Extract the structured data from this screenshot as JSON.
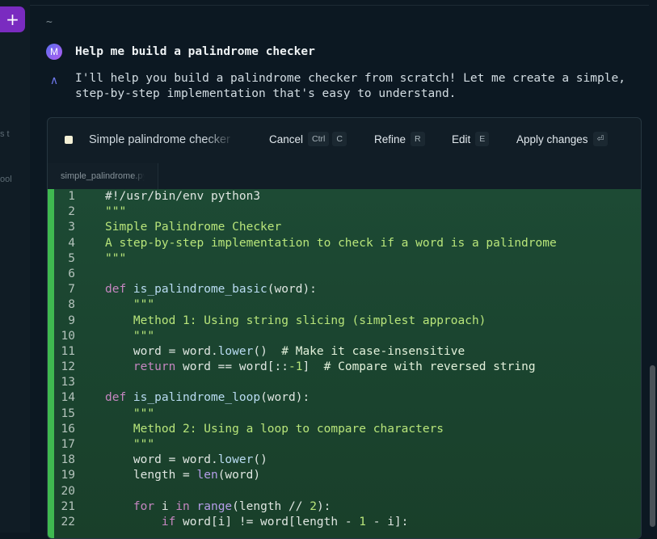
{
  "sidebar": {
    "new_button": "+",
    "fragment1": "s t",
    "fragment2": "ool"
  },
  "terminal": {
    "prompt": "~"
  },
  "conversation": {
    "user_avatar": "M",
    "user_message": "Help me build a palindrome checker",
    "assistant_icon": "∧",
    "assistant_message": "I'll help you build a palindrome checker from scratch! Let me create a simple, step-by-step implementation that's easy to understand."
  },
  "panel": {
    "title": "Simple palindrome checker",
    "actions": [
      {
        "label": "Cancel",
        "keys": [
          "Ctrl",
          "C"
        ]
      },
      {
        "label": "Refine",
        "keys": [
          "R"
        ]
      },
      {
        "label": "Edit",
        "keys": [
          "E"
        ]
      },
      {
        "label": "Apply changes",
        "keys": [
          "⏎"
        ]
      }
    ],
    "tab": "simple_palindrome.py"
  },
  "code_lines": [
    {
      "n": "1",
      "t": [
        [
          "",
          "#!/usr/bin/env python3"
        ]
      ]
    },
    {
      "n": "2",
      "t": [
        [
          "str",
          "\"\"\""
        ]
      ]
    },
    {
      "n": "3",
      "t": [
        [
          "str",
          "Simple Palindrome Checker"
        ]
      ]
    },
    {
      "n": "4",
      "t": [
        [
          "str",
          "A step-by-step implementation to check if a word is a palindrome"
        ]
      ]
    },
    {
      "n": "5",
      "t": [
        [
          "str",
          "\"\"\""
        ]
      ]
    },
    {
      "n": "6",
      "t": [
        [
          "",
          ""
        ]
      ]
    },
    {
      "n": "7",
      "t": [
        [
          "kw",
          "def "
        ],
        [
          "fn",
          "is_palindrome_basic"
        ],
        [
          "",
          "(word):"
        ]
      ]
    },
    {
      "n": "8",
      "t": [
        [
          "str",
          "    \"\"\""
        ]
      ]
    },
    {
      "n": "9",
      "t": [
        [
          "str",
          "    Method 1: Using string slicing (simplest approach)"
        ]
      ]
    },
    {
      "n": "10",
      "t": [
        [
          "str",
          "    \"\"\""
        ]
      ]
    },
    {
      "n": "11",
      "t": [
        [
          "",
          "    word = word."
        ],
        [
          "fn",
          "lower"
        ],
        [
          "",
          "()  "
        ],
        [
          "cm",
          "# Make it case-insensitive"
        ]
      ]
    },
    {
      "n": "12",
      "t": [
        [
          "kw",
          "    return "
        ],
        [
          "",
          "word == word[::"
        ],
        [
          "num",
          "-1"
        ],
        [
          "",
          "]  "
        ],
        [
          "cm",
          "# Compare with reversed string"
        ]
      ]
    },
    {
      "n": "13",
      "t": [
        [
          "",
          ""
        ]
      ]
    },
    {
      "n": "14",
      "t": [
        [
          "kw",
          "def "
        ],
        [
          "fn",
          "is_palindrome_loop"
        ],
        [
          "",
          "(word):"
        ]
      ]
    },
    {
      "n": "15",
      "t": [
        [
          "str",
          "    \"\"\""
        ]
      ]
    },
    {
      "n": "16",
      "t": [
        [
          "str",
          "    Method 2: Using a loop to compare characters"
        ]
      ]
    },
    {
      "n": "17",
      "t": [
        [
          "str",
          "    \"\"\""
        ]
      ]
    },
    {
      "n": "18",
      "t": [
        [
          "",
          "    word = word."
        ],
        [
          "fn",
          "lower"
        ],
        [
          "",
          "()"
        ]
      ]
    },
    {
      "n": "19",
      "t": [
        [
          "",
          "    length = "
        ],
        [
          "bi",
          "len"
        ],
        [
          "",
          "(word)"
        ]
      ]
    },
    {
      "n": "20",
      "t": [
        [
          "",
          ""
        ]
      ]
    },
    {
      "n": "21",
      "t": [
        [
          "kw",
          "    for "
        ],
        [
          "",
          "i "
        ],
        [
          "kw",
          "in "
        ],
        [
          "bi",
          "range"
        ],
        [
          "",
          "(length // "
        ],
        [
          "num",
          "2"
        ],
        [
          "",
          "):"
        ]
      ]
    },
    {
      "n": "22",
      "t": [
        [
          "kw",
          "        if "
        ],
        [
          "",
          "word[i] != word[length - "
        ],
        [
          "num",
          "1"
        ],
        [
          "",
          " - i]:"
        ]
      ]
    }
  ],
  "colors": {
    "accent": "#7a2bc0",
    "diff_added": "#3fb950",
    "background": "#0c1822"
  }
}
